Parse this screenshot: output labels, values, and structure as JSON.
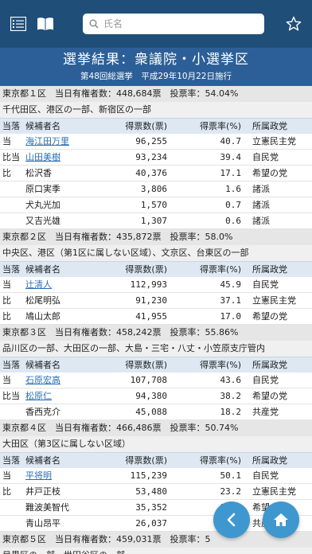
{
  "topbar": {
    "search_placeholder": "氏名"
  },
  "header": {
    "title": "選挙結果：衆議院・小選挙区",
    "subtitle": "第48回総選挙　平成29年10月22日施行"
  },
  "columns": [
    "当落",
    "候補者名",
    "得票数(票)",
    "得票率(%)",
    "所属政党"
  ],
  "districts": [
    {
      "info": "東京都１区　当日有権者数：448,684票　投票率：54.04%",
      "area": "千代田区、港区の一部、新宿区の一部",
      "rows": [
        {
          "result": "当",
          "name": "海江田万里",
          "link": true,
          "votes": "96,255",
          "rate": "40.7",
          "party": "立憲民主党"
        },
        {
          "result": "比当",
          "name": "山田美樹",
          "link": true,
          "votes": "93,234",
          "rate": "39.4",
          "party": "自民党"
        },
        {
          "result": "比",
          "name": "松沢香",
          "link": false,
          "votes": "40,376",
          "rate": "17.1",
          "party": "希望の党"
        },
        {
          "result": "",
          "name": "原口実季",
          "link": false,
          "votes": "3,806",
          "rate": "1.6",
          "party": "諸派"
        },
        {
          "result": "",
          "name": "犬丸光加",
          "link": false,
          "votes": "1,570",
          "rate": "0.7",
          "party": "諸派"
        },
        {
          "result": "",
          "name": "又吉光雄",
          "link": false,
          "votes": "1,307",
          "rate": "0.6",
          "party": "諸派"
        }
      ]
    },
    {
      "info": "東京都２区　当日有権者数：435,872票　投票率：58.0%",
      "area": "中央区、港区（第1区に属しない区域）、文京区、台東区の一部",
      "rows": [
        {
          "result": "当",
          "name": "辻清人",
          "link": true,
          "votes": "112,993",
          "rate": "45.9",
          "party": "自民党"
        },
        {
          "result": "比",
          "name": "松尾明弘",
          "link": false,
          "votes": "91,230",
          "rate": "37.1",
          "party": "立憲民主党"
        },
        {
          "result": "比",
          "name": "鳩山太郎",
          "link": false,
          "votes": "41,955",
          "rate": "17.0",
          "party": "希望の党"
        }
      ]
    },
    {
      "info": "東京都３区　当日有権者数：458,242票　投票率：55.86%",
      "area": "品川区の一部、大田区の一部、大島・三宅・八丈・小笠原支庁管内",
      "rows": [
        {
          "result": "当",
          "name": "石原宏高",
          "link": true,
          "votes": "107,708",
          "rate": "43.6",
          "party": "自民党"
        },
        {
          "result": "比当",
          "name": "松原仁",
          "link": true,
          "votes": "94,380",
          "rate": "38.2",
          "party": "希望の党"
        },
        {
          "result": "",
          "name": "香西克介",
          "link": false,
          "votes": "45,088",
          "rate": "18.2",
          "party": "共産党"
        }
      ]
    },
    {
      "info": "東京都４区　当日有権者数：466,486票　投票率：50.74%",
      "area": "大田区（第3区に属しない区域）",
      "rows": [
        {
          "result": "当",
          "name": "平将明",
          "link": true,
          "votes": "115,239",
          "rate": "50.1",
          "party": "自民党"
        },
        {
          "result": "比",
          "name": "井戸正枝",
          "link": false,
          "votes": "53,480",
          "rate": "23.2",
          "party": "立憲民主党"
        },
        {
          "result": "",
          "name": "難波美智代",
          "link": false,
          "votes": "35,352",
          "rate": "15.4",
          "party": "希望の党"
        },
        {
          "result": "",
          "name": "青山昂平",
          "link": false,
          "votes": "26,037",
          "rate": "11.3",
          "party": "共産党"
        }
      ]
    },
    {
      "info": "東京都５区　当日有権者数：459,031票　投票率：5",
      "area": "目黒区の一部、世田谷区の一部",
      "rows": []
    }
  ],
  "colors": {
    "topbar": "#1f4e79",
    "header": "#2c5f97",
    "fab": "#3f97d0",
    "link": "#2a6db5"
  }
}
